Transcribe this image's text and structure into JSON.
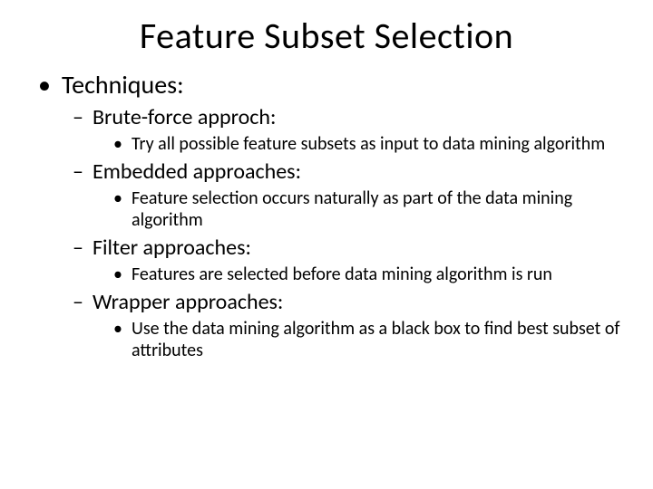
{
  "title": "Feature Subset Selection",
  "heading": "Techniques:",
  "items": [
    {
      "label": "Brute-force approch:",
      "detail": "Try all possible feature subsets as input to data mining algorithm"
    },
    {
      "label": "Embedded approaches:",
      "detail": " Feature selection occurs naturally as part of the data mining algorithm"
    },
    {
      "label": "Filter approaches:",
      "detail": " Features are selected before data mining algorithm is run"
    },
    {
      "label": "Wrapper approaches:",
      "detail": " Use the data mining algorithm as a black box to find best subset of attributes"
    }
  ]
}
